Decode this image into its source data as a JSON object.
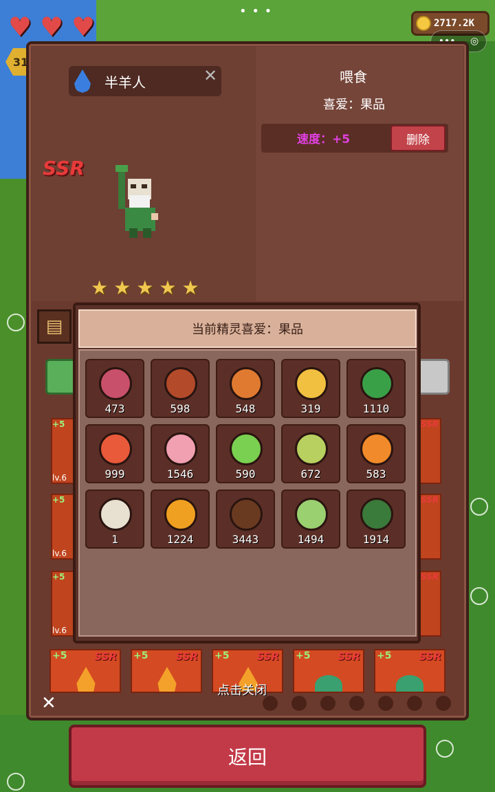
{
  "hud": {
    "hearts": [
      "heart",
      "heart",
      "heart"
    ],
    "level_badge": "31",
    "coins": "2717.2K",
    "topdots": "• • •",
    "capsule": {
      "more": "•••",
      "target": "◎"
    }
  },
  "detail": {
    "name": "半羊人",
    "close": "✕",
    "rarity": "SSR",
    "stars": [
      "★",
      "★",
      "★",
      "★",
      "★"
    ],
    "feed_title": "喂食",
    "favorite": "喜爱：果品",
    "speed": "速度：+5",
    "delete_label": "删除"
  },
  "popup": {
    "header": "当前精灵喜爱：果品",
    "items": [
      {
        "name": "steak",
        "count": "473",
        "color": "#c9506a"
      },
      {
        "name": "roast-chicken",
        "count": "598",
        "color": "#b34a2a"
      },
      {
        "name": "pizza",
        "count": "548",
        "color": "#e07a30"
      },
      {
        "name": "omelette",
        "count": "319",
        "color": "#f2c040"
      },
      {
        "name": "salad",
        "count": "1110",
        "color": "#3aa048"
      },
      {
        "name": "meat-drumstick",
        "count": "999",
        "color": "#e85a3a"
      },
      {
        "name": "strawberry-smoothie",
        "count": "1546",
        "color": "#f0a0b0"
      },
      {
        "name": "green-juice",
        "count": "590",
        "color": "#7ad050"
      },
      {
        "name": "grapes",
        "count": "672",
        "color": "#b8d060"
      },
      {
        "name": "orange-juice",
        "count": "583",
        "color": "#f08a2a"
      },
      {
        "name": "dango-skewer",
        "count": "1",
        "color": "#e8e0d0"
      },
      {
        "name": "grilled-skewers",
        "count": "1224",
        "color": "#f0a020"
      },
      {
        "name": "beer-barrel",
        "count": "3443",
        "color": "#6a3a20"
      },
      {
        "name": "sake-bottle",
        "count": "1494",
        "color": "#9ad070"
      },
      {
        "name": "wine-bottle",
        "count": "1914",
        "color": "#3a7a3a"
      }
    ]
  },
  "cards": {
    "plus": "+5",
    "rarity": "SSR",
    "level_prefix": "lv.6",
    "bottom": [
      {
        "type": "flame"
      },
      {
        "type": "flame"
      },
      {
        "type": "flame"
      },
      {
        "type": "slime"
      },
      {
        "type": "slime"
      }
    ]
  },
  "footer": {
    "close_hint": "点击关闭",
    "panel_close": "✕",
    "back_label": "返回"
  }
}
